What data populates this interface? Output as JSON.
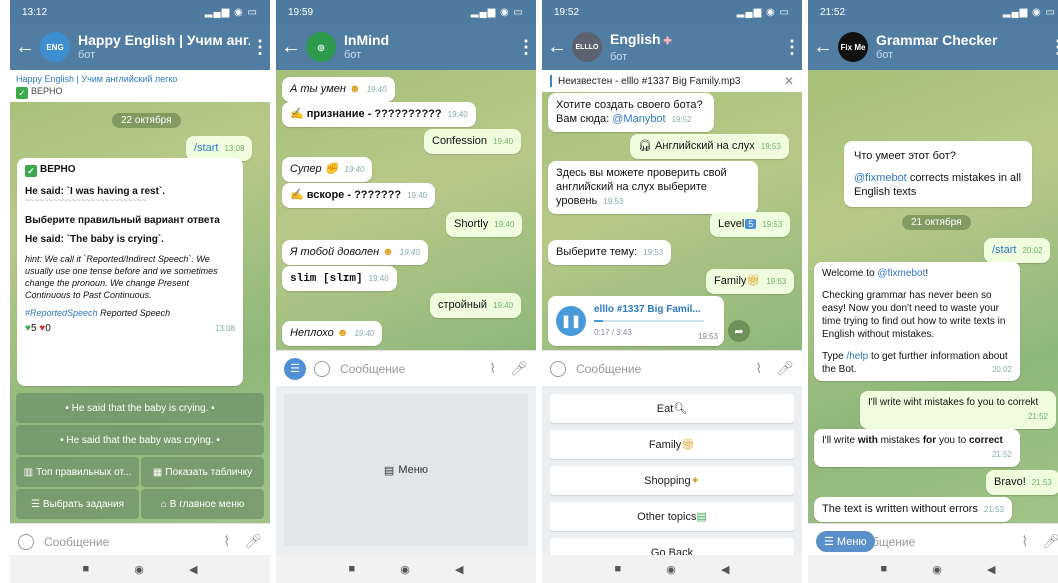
{
  "phones": [
    {
      "time": "13:12",
      "title": "Happy English | Учим англ",
      "subtitle": "бот",
      "pinned_title": "Happy English | Учим английский легко",
      "pinned_text": "ВЕРНО",
      "date": "22 октября",
      "start_cmd": "/start",
      "start_time": "13:08",
      "msg_verno": "ВЕРНО",
      "msg_said1": "He said: `I was having a rest`.",
      "msg_choose": "Выберите правильный вариант ответа",
      "msg_said2": "He said: `The baby is crying`.",
      "msg_hint": "hint: We call it `Reported/Indirect Speech`. We usually use one tense before and we sometimes change the pronoun. We change Present Continuous to Past Continuous.",
      "hashtag": "#ReportedSpeech",
      "hashtag_rest": "Reported Speech",
      "likes": "5",
      "hearts": "0",
      "msg_time": "13:08",
      "kb_opt1": "• He said that the baby is crying. •",
      "kb_opt2": "• He said that the baby was crying. •",
      "kb_top": "Топ правильных от...",
      "kb_table": "Показать табличку",
      "kb_tasks": "Выбрать задания",
      "kb_menu": "В главное меню",
      "input_placeholder": "Сообщение"
    },
    {
      "time": "19:59",
      "title": "InMind",
      "subtitle": "бот",
      "m1": "А ты умен",
      "m1_t": "19:40",
      "m2": "признание - ??????????",
      "m2_t": "19:40",
      "m3": "Confession",
      "m3_t": "19:40",
      "m4": "Супер",
      "m4_t": "19:40",
      "m5": "вскоре - ???????",
      "m5_t": "19:40",
      "m6": "Shortly",
      "m6_t": "19:40",
      "m7": "Я тобой доволен",
      "m7_t": "19:40",
      "m8": "slim [slɪm]",
      "m8_t": "19:40",
      "m9": "стройный",
      "m9_t": "19:40",
      "m10": "Неплохо",
      "m10_t": "19:40",
      "input_placeholder": "Сообщение",
      "menu_label": "Меню"
    },
    {
      "time": "19:52",
      "title": "English",
      "subtitle": "бот",
      "pinned": "Неизвестен - elllo #1337 Big Family.mp3",
      "m1": "Хотите создать своего бота? Вам сюда:",
      "m1_link": "@Manybot",
      "m1_t": "19:52",
      "m2": "Английский на слух",
      "m2_t": "19:53",
      "m3": "Здесь вы можете проверить свой английский на слух выберите уровень",
      "m3_t": "19:53",
      "m4": "Level",
      "m4_badge": "5",
      "m4_t": "19:53",
      "m5": "Выберите тему:",
      "m5_t": "19:53",
      "m6": "Family",
      "m6_t": "19:53",
      "audio_title": "elllo #1337 Big Famil...",
      "audio_dur": "0:17 / 3:43",
      "audio_t": "19:53",
      "audio_progress": 0.08,
      "input_placeholder": "Сообщение",
      "kb": [
        "Eat",
        "Family",
        "Shopping",
        "Other topics",
        "Go Back"
      ]
    },
    {
      "time": "21:52",
      "title": "Grammar Checker",
      "subtitle": "бот",
      "intro_title": "Что умеет этот бот?",
      "intro_link": "@fixmebot",
      "intro_rest": "corrects mistakes in all English texts",
      "date": "21 октября",
      "start_cmd": "/start",
      "start_time": "20:02",
      "w_hello": "Welcome to",
      "w_link": "@fixmebot",
      "w_p1": "Checking grammar has never been so easy! Now you don't need to waste your time trying to find out how to write texts in English without mistakes.",
      "w_type": "Type",
      "w_help": "/help",
      "w_rest": "to get further information about the Bot.",
      "w_time": "20:02",
      "m_wrong": "I'll write wiht mistakes fo you to correkt",
      "m_wrong_t": "21:52",
      "m_fix_a": "I'll write ",
      "m_fix_b": "with",
      "m_fix_c": " mistakes ",
      "m_fix_d": "for",
      "m_fix_e": " you to ",
      "m_fix_f": "correct",
      "m_fix_t": "21:52",
      "m_bravo": "Bravo!",
      "m_bravo_t": "21:53",
      "m_ok": "The text is written without errors",
      "m_ok_t": "21:53",
      "menu_label": "Меню",
      "input_placeholder": "Сообщение"
    }
  ],
  "colors": {
    "header": "#527da3",
    "statusbar": "#4f7ba0",
    "outgoing": "#effdde",
    "keyboard_btn": "#74976c"
  }
}
